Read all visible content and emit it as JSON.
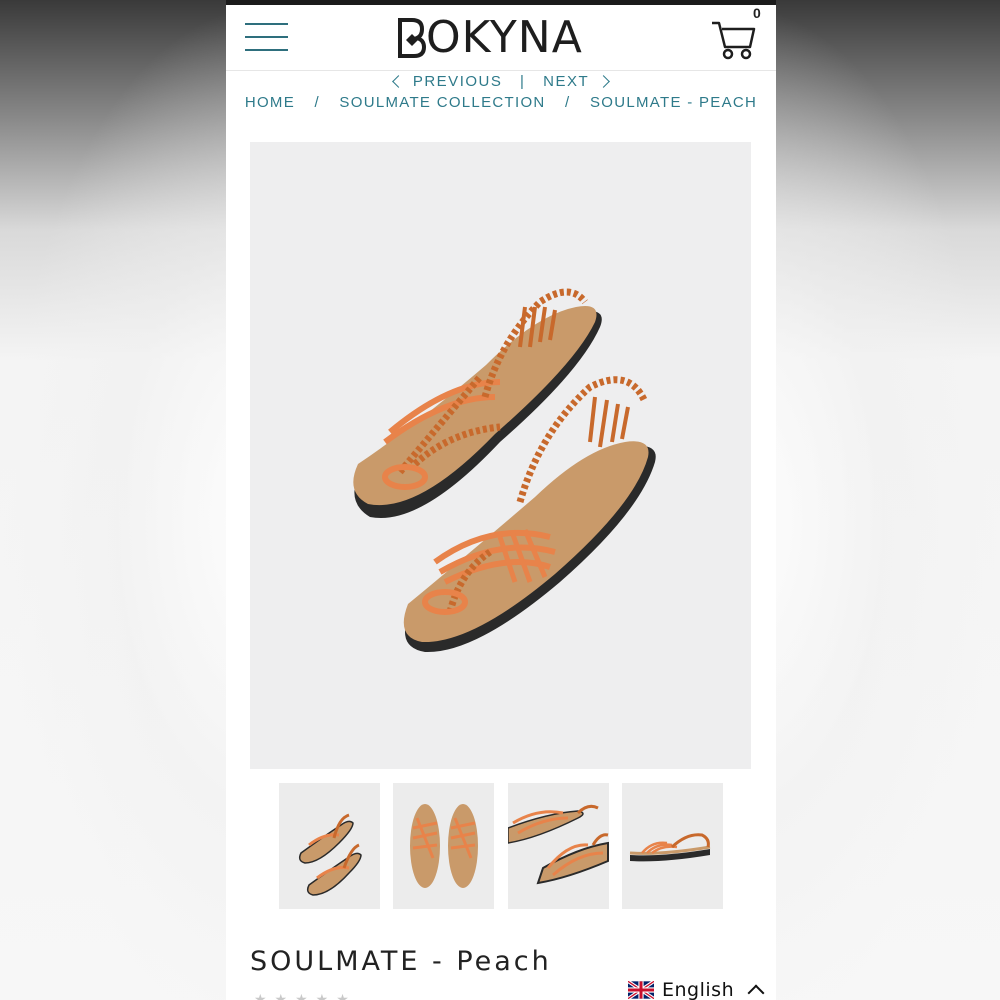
{
  "header": {
    "brand": "BOKYNA",
    "cart_count": "0"
  },
  "nav": {
    "previous_label": "PREVIOUS",
    "separator": "|",
    "next_label": "NEXT"
  },
  "breadcrumb": {
    "items": [
      "HOME",
      "SOULMATE COLLECTION",
      "SOULMATE - PEACH"
    ],
    "separator": "/"
  },
  "product": {
    "title": "SOULMATE - Peach",
    "rating_stars": "★★★★★",
    "thumbnail_count": 4
  },
  "language": {
    "label": "English"
  },
  "colors": {
    "accent": "#2e7a8a",
    "menu_lines": "#2e6f7d",
    "sandal_strap": "#e8834a",
    "sandal_braid": "#c8692c",
    "cork": "#c99a6a"
  }
}
